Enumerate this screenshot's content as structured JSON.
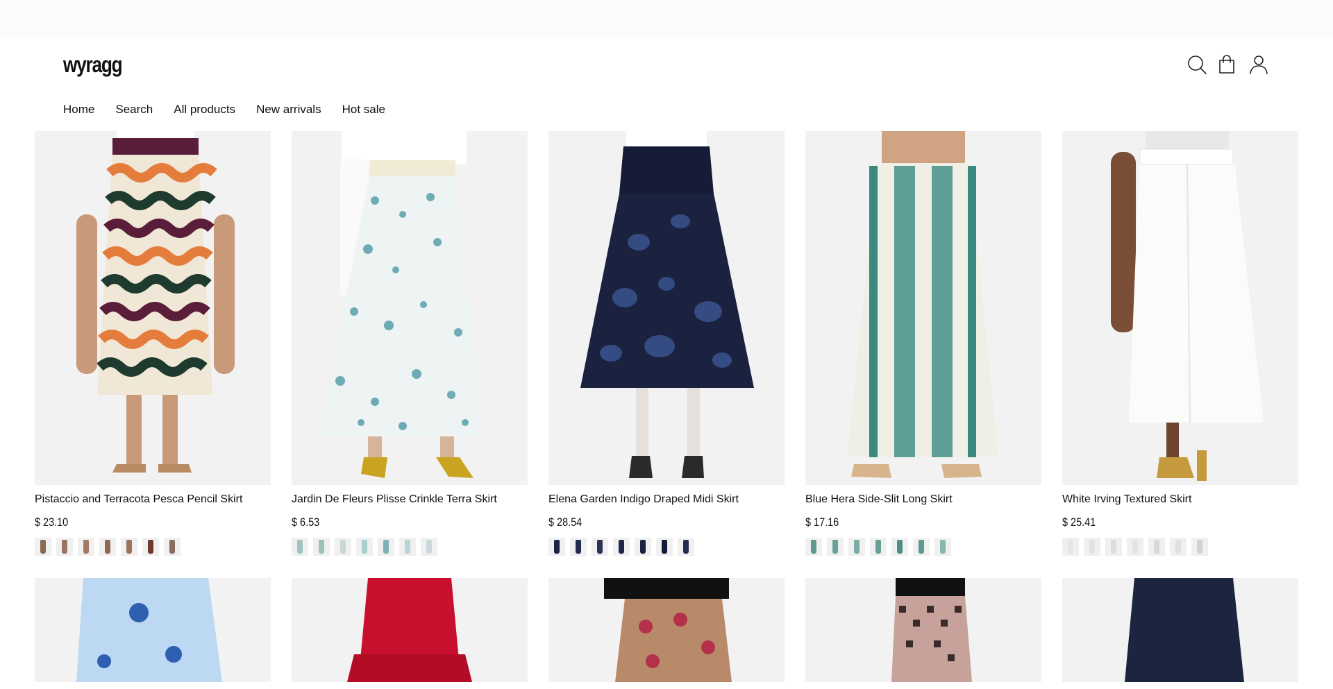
{
  "brand": {
    "logo": "wyragg"
  },
  "nav": [
    "Home",
    "Search",
    "All products",
    "New arrivals",
    "Hot sale"
  ],
  "header_icons": [
    "search-icon",
    "shopping-bag-icon",
    "user-icon"
  ],
  "products": [
    {
      "name": "Pistaccio and Terracota Pesca Pencil Skirt",
      "price": "$ 23.10",
      "swatch_colors": [
        "#8a6a56",
        "#9a7560",
        "#a07a62",
        "#8f6750",
        "#9c7258",
        "#6e3a2c",
        "#8a6c5c"
      ]
    },
    {
      "name": "Jardin De Fleurs Plisse Crinkle Terra Skirt",
      "price": "$ 6.53",
      "swatch_colors": [
        "#9fc3c2",
        "#9cc2bc",
        "#c9d8d6",
        "#aacfcf",
        "#7fb2b3",
        "#b8d3d8",
        "#cad8dc"
      ]
    },
    {
      "name": "Elena Garden Indigo Draped Midi Skirt",
      "price": "$ 28.54",
      "swatch_colors": [
        "#1c2344",
        "#222a4e",
        "#2c3155",
        "#1f2749",
        "#1b2140",
        "#141a3a",
        "#252c52"
      ]
    },
    {
      "name": "Blue Hera Side-Slit Long Skirt",
      "price": "$ 17.16",
      "swatch_colors": [
        "#5f9a92",
        "#6aa29b",
        "#7aaba5",
        "#6a9f98",
        "#4f8e86",
        "#5e9892",
        "#88b4ae"
      ]
    },
    {
      "name": "White Irving Textured Skirt",
      "price": "$ 25.41",
      "swatch_colors": [
        "#e6e6e4",
        "#e2e2e0",
        "#dcdcda",
        "#e4e4e2",
        "#d8d8d6",
        "#e0e0de",
        "#d2d2d0"
      ]
    }
  ],
  "second_row": [
    {
      "name": "light-blue-floral-skirt"
    },
    {
      "name": "red-ruffle-skirt"
    },
    {
      "name": "pink-pattern-skirt"
    },
    {
      "name": "checkered-skirt"
    },
    {
      "name": "navy-pleated-skirt"
    }
  ]
}
